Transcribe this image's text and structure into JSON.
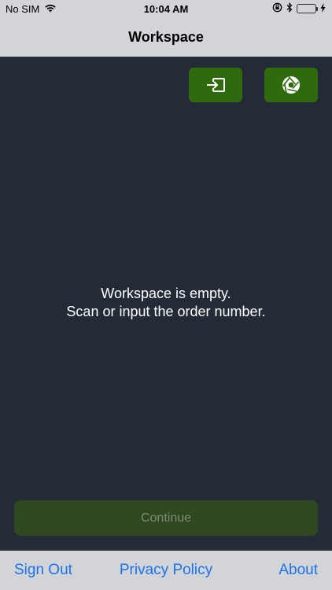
{
  "status_bar": {
    "carrier": "No SIM",
    "time": "10:04 AM",
    "battery_level": 0.65
  },
  "nav": {
    "title": "Workspace"
  },
  "toolbar_buttons": {
    "input_icon": "keyboard-input-icon",
    "camera_icon": "camera-aperture-icon",
    "button_color": "#2f6b0e"
  },
  "workspace": {
    "empty_line1": "Workspace is empty.",
    "empty_line2": "Scan or input the order number.",
    "background": "#232b36"
  },
  "continue": {
    "label": "Continue",
    "enabled": false
  },
  "bottom_links": {
    "sign_out": "Sign Out",
    "privacy_policy": "Privacy Policy",
    "about": "About",
    "link_color": "#1a73e8"
  }
}
